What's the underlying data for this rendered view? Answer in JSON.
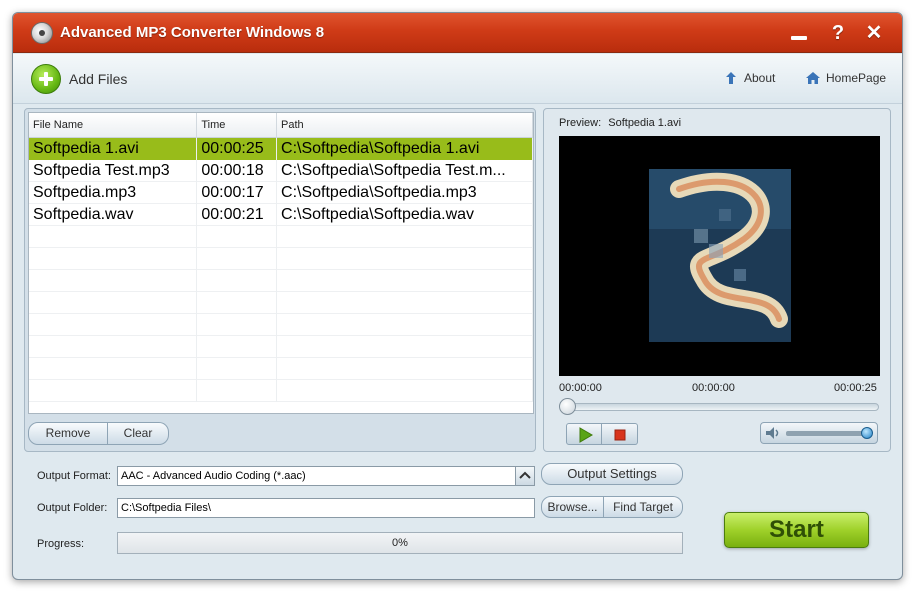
{
  "window": {
    "title": "Advanced MP3 Converter Windows 8",
    "app_icon": "cd-icon",
    "controls": {
      "minimize_icon": "minimize-icon",
      "help_label": "?",
      "close_label": "✕"
    }
  },
  "toolbar": {
    "add_files_label": "Add Files",
    "add_files_icon": "plus-icon",
    "about_label": "About",
    "homepage_label": "HomePage"
  },
  "file_list": {
    "columns": [
      "File Name",
      "Time",
      "Path"
    ],
    "rows": [
      {
        "name": "Softpedia 1.avi",
        "time": "00:00:25",
        "path": "C:\\Softpedia\\Softpedia 1.avi",
        "selected": true
      },
      {
        "name": "Softpedia Test.mp3",
        "time": "00:00:18",
        "path": "C:\\Softpedia\\Softpedia Test.m...",
        "selected": false
      },
      {
        "name": "Softpedia.mp3",
        "time": "00:00:17",
        "path": "C:\\Softpedia\\Softpedia.mp3",
        "selected": false
      },
      {
        "name": "Softpedia.wav",
        "time": "00:00:21",
        "path": "C:\\Softpedia\\Softpedia.wav",
        "selected": false
      }
    ],
    "remove_label": "Remove",
    "clear_label": "Clear"
  },
  "preview": {
    "label": "Preview:",
    "file": "Softpedia 1.avi",
    "time_start": "00:00:00",
    "time_current": "00:00:00",
    "time_end": "00:00:25",
    "seek_fraction": 0,
    "volume_fraction": 1.0
  },
  "output": {
    "format_label": "Output Format:",
    "format_value": "AAC - Advanced Audio Coding (*.aac)",
    "settings_label": "Output Settings",
    "folder_label": "Output Folder:",
    "folder_value": "C:\\Softpedia Files\\",
    "browse_label": "Browse...",
    "find_target_label": "Find Target",
    "progress_label": "Progress:",
    "progress_text": "0%",
    "progress_fraction": 0
  },
  "start_label": "Start",
  "colors": {
    "titlebar": "#cf3b17",
    "selected_row": "#98bc1a",
    "start_button": "#9fd12a"
  }
}
